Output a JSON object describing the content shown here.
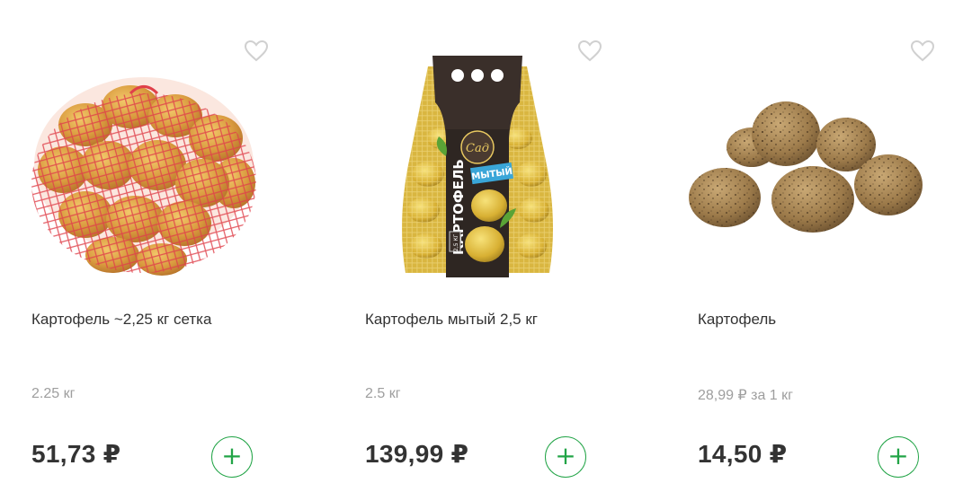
{
  "colors": {
    "accent_green": "#22a447",
    "text_primary": "#333333",
    "text_muted": "#9e9e9e",
    "icon_outline": "#d0d0d0"
  },
  "products": [
    {
      "title": "Картофель ~2,25 кг сетка",
      "weight": "2.25 кг",
      "price": "51,73 ₽",
      "image": "potatoes-in-red-net",
      "favorite_icon": "heart-outline-icon",
      "add_icon": "plus-icon",
      "add_symbol": "+"
    },
    {
      "title": "Картофель мытый 2,5 кг",
      "weight": "2.5 кг",
      "price": "139,99 ₽",
      "image": "washed-potatoes-bag",
      "package_brand": "Сад",
      "package_product": "КАРТОФЕЛЬ",
      "package_variant": "МЫТЫЙ",
      "package_weight": "2,5 КГ",
      "favorite_icon": "heart-outline-icon",
      "add_icon": "plus-icon",
      "add_symbol": "+"
    },
    {
      "title": "Картофель",
      "weight": "28,99 ₽ за 1 кг",
      "price": "14,50 ₽",
      "image": "loose-potatoes",
      "favorite_icon": "heart-outline-icon",
      "add_icon": "plus-icon",
      "add_symbol": "+"
    }
  ]
}
